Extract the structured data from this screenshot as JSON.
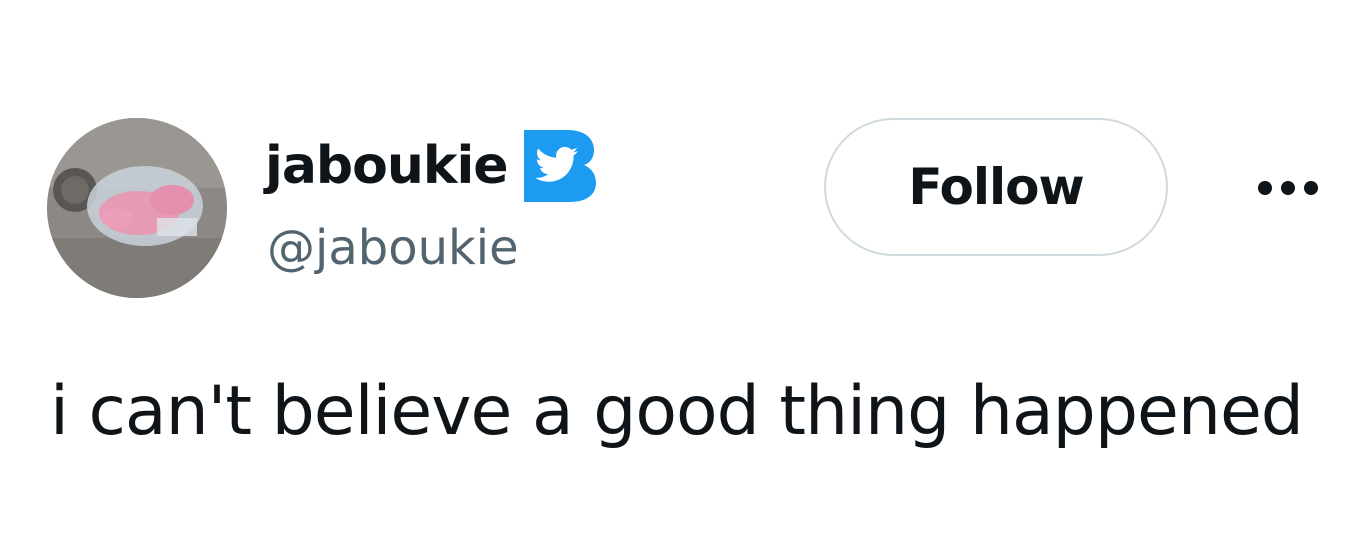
{
  "author": {
    "display_name": "jaboukie",
    "handle": "@jaboukie",
    "verified_icon": "twitter-verified-badge-icon",
    "avatar_icon": "avatar-photo"
  },
  "actions": {
    "follow_label": "Follow",
    "more_icon": "more-options-icon"
  },
  "tweet": {
    "text": "i can't believe a good thing happened"
  },
  "colors": {
    "text_primary": "#0f1419",
    "text_secondary": "#536471",
    "badge_blue": "#1d9bf0",
    "button_border": "#cfd9de",
    "background": "#ffffff"
  }
}
